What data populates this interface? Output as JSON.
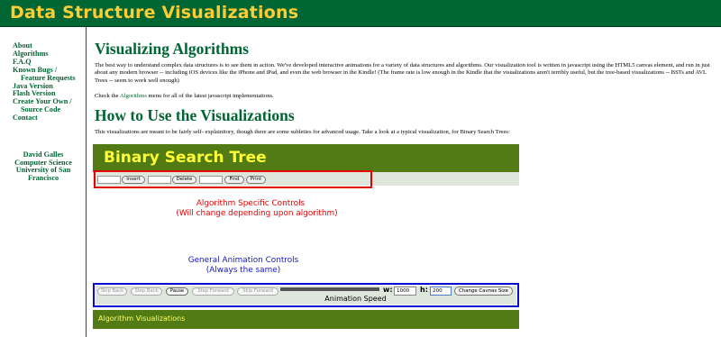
{
  "header": {
    "title": "Data Structure Visualizations"
  },
  "sidebar": {
    "nav": [
      {
        "label": "About"
      },
      {
        "label": "Algorithms"
      },
      {
        "label": "F.A.Q"
      },
      {
        "label": "Known Bugs /",
        "sub": "Feature Requests"
      },
      {
        "label": "Java Version"
      },
      {
        "label": "Flash Version"
      },
      {
        "label": "Create Your Own /",
        "sub": "Source Code"
      },
      {
        "label": "Contact"
      }
    ],
    "affiliation": [
      "David Galles",
      "Computer Science",
      "University of San",
      "Francisco"
    ]
  },
  "main": {
    "heading1": "Visualizing Algorithms",
    "intro": "The best way to understand complex data structures is to see them in action. We've developed interactive animations for a variety of data structures and algorithms. Our visualization tool is written in javascript using the HTML5 canvas element, and run in just about any modern browser -- including iOS devices like the iPhone and iPad, and even the web browser in the Kindle! (The frame rate is low enough in the Kindle that the visualizations aren't terribly useful, but the tree-based visualizations -- BSTs and AVL Trees -- seem to work well enough)",
    "check_prefix": "Check the ",
    "check_link": "Algorithms",
    "check_suffix": " menu for all of the latest javascript implementations.",
    "heading2": "How to Use the Visualizations",
    "howto_text": "This visualizations are meant to be fairly self- explainitory, though there are some subleties for advanced usage. Take a look at a typical visualization, for Binary Search Trees:"
  },
  "demo": {
    "title": "Binary Search Tree",
    "controls": {
      "insert": "Insert",
      "delete": "Delete",
      "find": "Find",
      "print": "Print"
    },
    "label_specific": [
      "Algorithm Specific Controls",
      "(Will change depending upon algorithm)"
    ],
    "label_general": [
      "General Animation Controls",
      "(Always the same)"
    ],
    "anim": {
      "skip_back": "Skip Back",
      "step_back": "Step Back",
      "pause": "Pause",
      "step_forward": "Step Forward",
      "skip_forward": "Skip Forward",
      "speed_label": "Animation Speed",
      "w_label": "w:",
      "w_value": "1000",
      "h_label": "h:",
      "h_value": "200",
      "change_size": "Change Cavnas Size"
    },
    "footer": "Algorithm Visualizations"
  },
  "colors": {
    "header_bg": "#006633",
    "header_text": "#ffcc33",
    "link": "#006633",
    "demo_green": "#527a15",
    "demo_title": "#ffff33",
    "annotation_red": "#e60000",
    "annotation_blue": "#1515cc"
  }
}
